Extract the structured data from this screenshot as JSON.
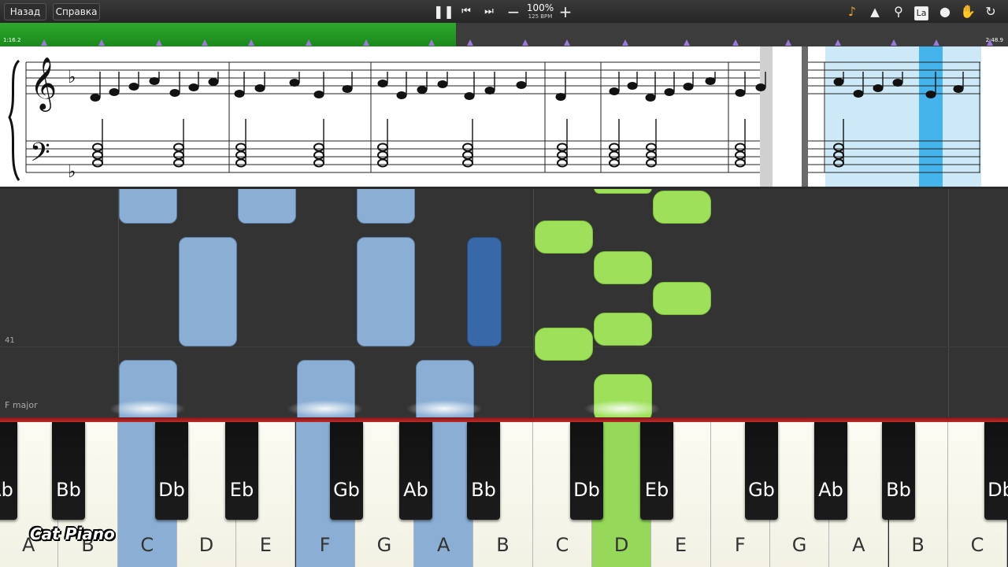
{
  "toolbar": {
    "back_label": "Назад",
    "help_label": "Справка",
    "tempo_percent": "100%",
    "tempo_bpm": "125 BPM",
    "icons": [
      "pause-icon",
      "skip-back-icon",
      "skip-forward-icon",
      "minus-icon",
      "plus-icon",
      "note-icon",
      "metronome-icon",
      "magnifier-icon",
      "la-icon",
      "location-pin-icon",
      "hand-icon",
      "loop-icon"
    ],
    "la_label": "La"
  },
  "progress": {
    "elapsed": "1:16.2",
    "total": "2:48.9",
    "fraction": 0.452,
    "fill_color": "#22a022"
  },
  "piano_roll": {
    "row_label": "41",
    "key_signature": "F major"
  },
  "keyboard": {
    "white_keys": [
      "A",
      "B",
      "C",
      "D",
      "E",
      "F",
      "G",
      "A",
      "B",
      "C",
      "D",
      "E",
      "F",
      "G",
      "A",
      "B",
      "C"
    ],
    "black_keys": [
      "Ab",
      "Bb",
      "Db",
      "Eb",
      "Gb",
      "Ab",
      "Bb",
      "Db",
      "Eb",
      "Gb",
      "Ab",
      "Bb",
      "Db"
    ]
  },
  "brand": "Cat Piano",
  "colors": {
    "left_hand": "#8aaed4",
    "right_hand": "#9ee05a",
    "accent_red": "#c52828"
  }
}
